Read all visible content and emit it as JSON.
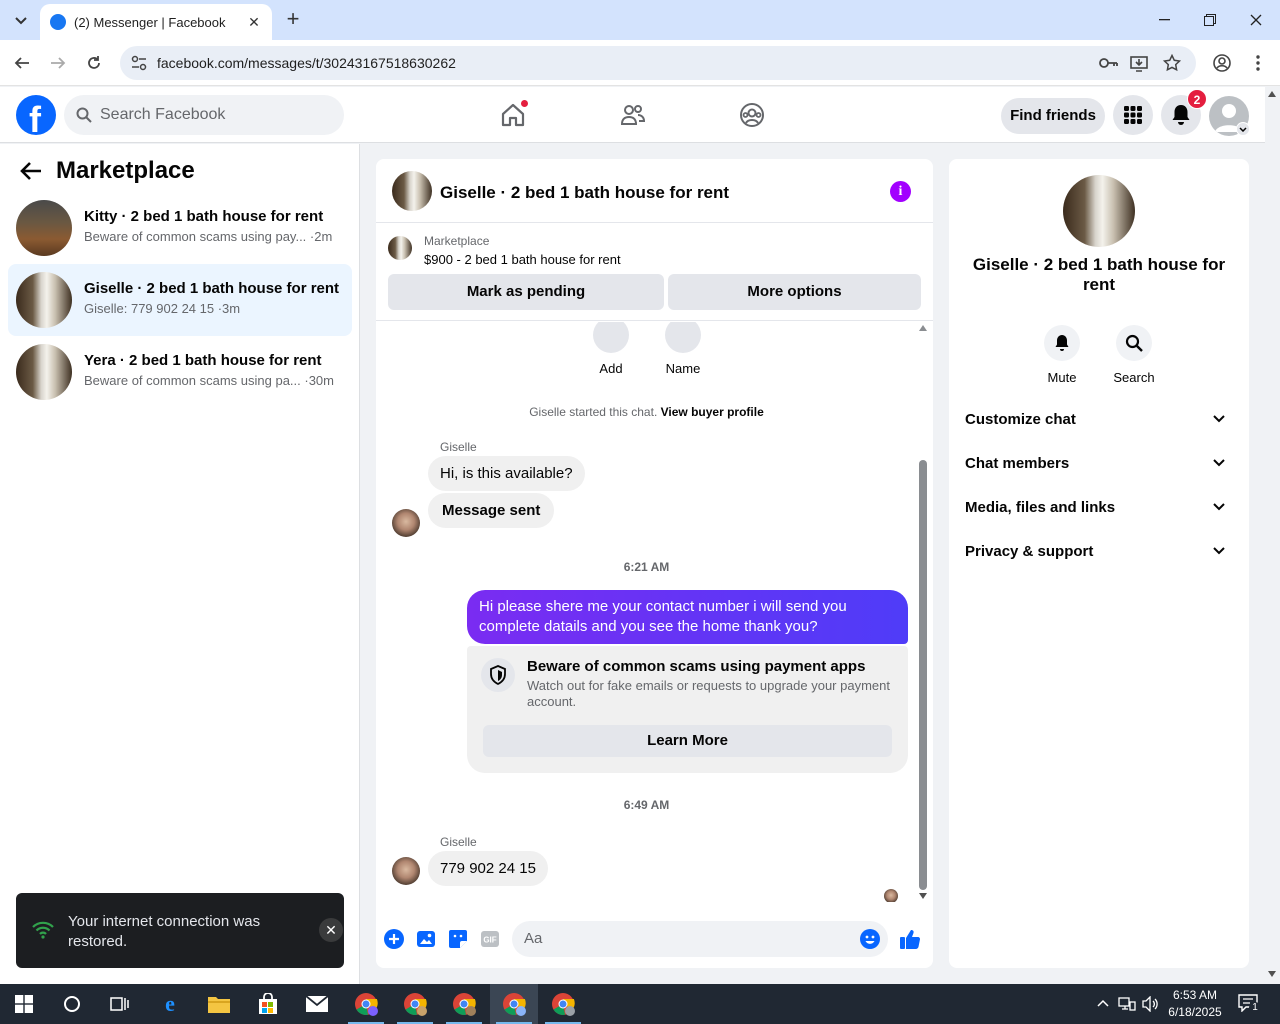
{
  "browser": {
    "tab_title": "(2) Messenger | Facebook",
    "url": "facebook.com/messages/t/30243167518630262"
  },
  "fb_header": {
    "search_placeholder": "Search Facebook",
    "find_friends": "Find friends",
    "notification_count": "2"
  },
  "sidebar": {
    "title": "Marketplace",
    "conversations": [
      {
        "name": "Kitty · 2 bed 1 bath house for rent",
        "snippet": "Beware of common scams using pay... ·2m",
        "active": false
      },
      {
        "name": "Giselle · 2 bed 1 bath house for rent",
        "snippet": "Giselle: 779 902 24 15 ·3m",
        "active": true
      },
      {
        "name": "Yera · 2 bed 1 bath house for rent",
        "snippet": "Beware of common scams using pa... ·30m",
        "active": false
      }
    ]
  },
  "toast": {
    "text": "Your internet connection was restored."
  },
  "chat": {
    "title": "Giselle · 2 bed 1 bath house for rent",
    "listing_label": "Marketplace",
    "listing_price": "$900 - 2 bed 1 bath house for rent",
    "mark_pending": "Mark as pending",
    "more_options": "More options",
    "action_add": "Add",
    "action_name": "Name",
    "started_text": "Giselle started this chat.",
    "view_profile": "View buyer profile",
    "sender_name": "Giselle",
    "msg1": "Hi, is this available?",
    "msg2": "Message sent",
    "time1": "6:21 AM",
    "my_msg": "Hi please shere me your contact number i will send you complete datails and you see the home thank you?",
    "scam_title": "Beware of common scams using payment apps",
    "scam_desc": "Watch out for fake emails or requests to upgrade your payment account.",
    "learn_more": "Learn More",
    "time2": "6:49 AM",
    "sender_name2": "Giselle",
    "msg3": "779 902 24 15",
    "input_placeholder": "Aa"
  },
  "details": {
    "name": "Giselle · 2 bed 1 bath house for rent",
    "mute": "Mute",
    "search": "Search",
    "sections": [
      "Customize chat",
      "Chat members",
      "Media, files and links",
      "Privacy & support"
    ]
  },
  "taskbar": {
    "time": "6:53 AM",
    "date": "6/18/2025",
    "notif_count": "1"
  },
  "colors": {
    "fb_blue": "#0866ff",
    "messenger_purple": "#a200ff",
    "my_bubble": "#6e2ef5",
    "active_conv": "#ebf5ff"
  }
}
